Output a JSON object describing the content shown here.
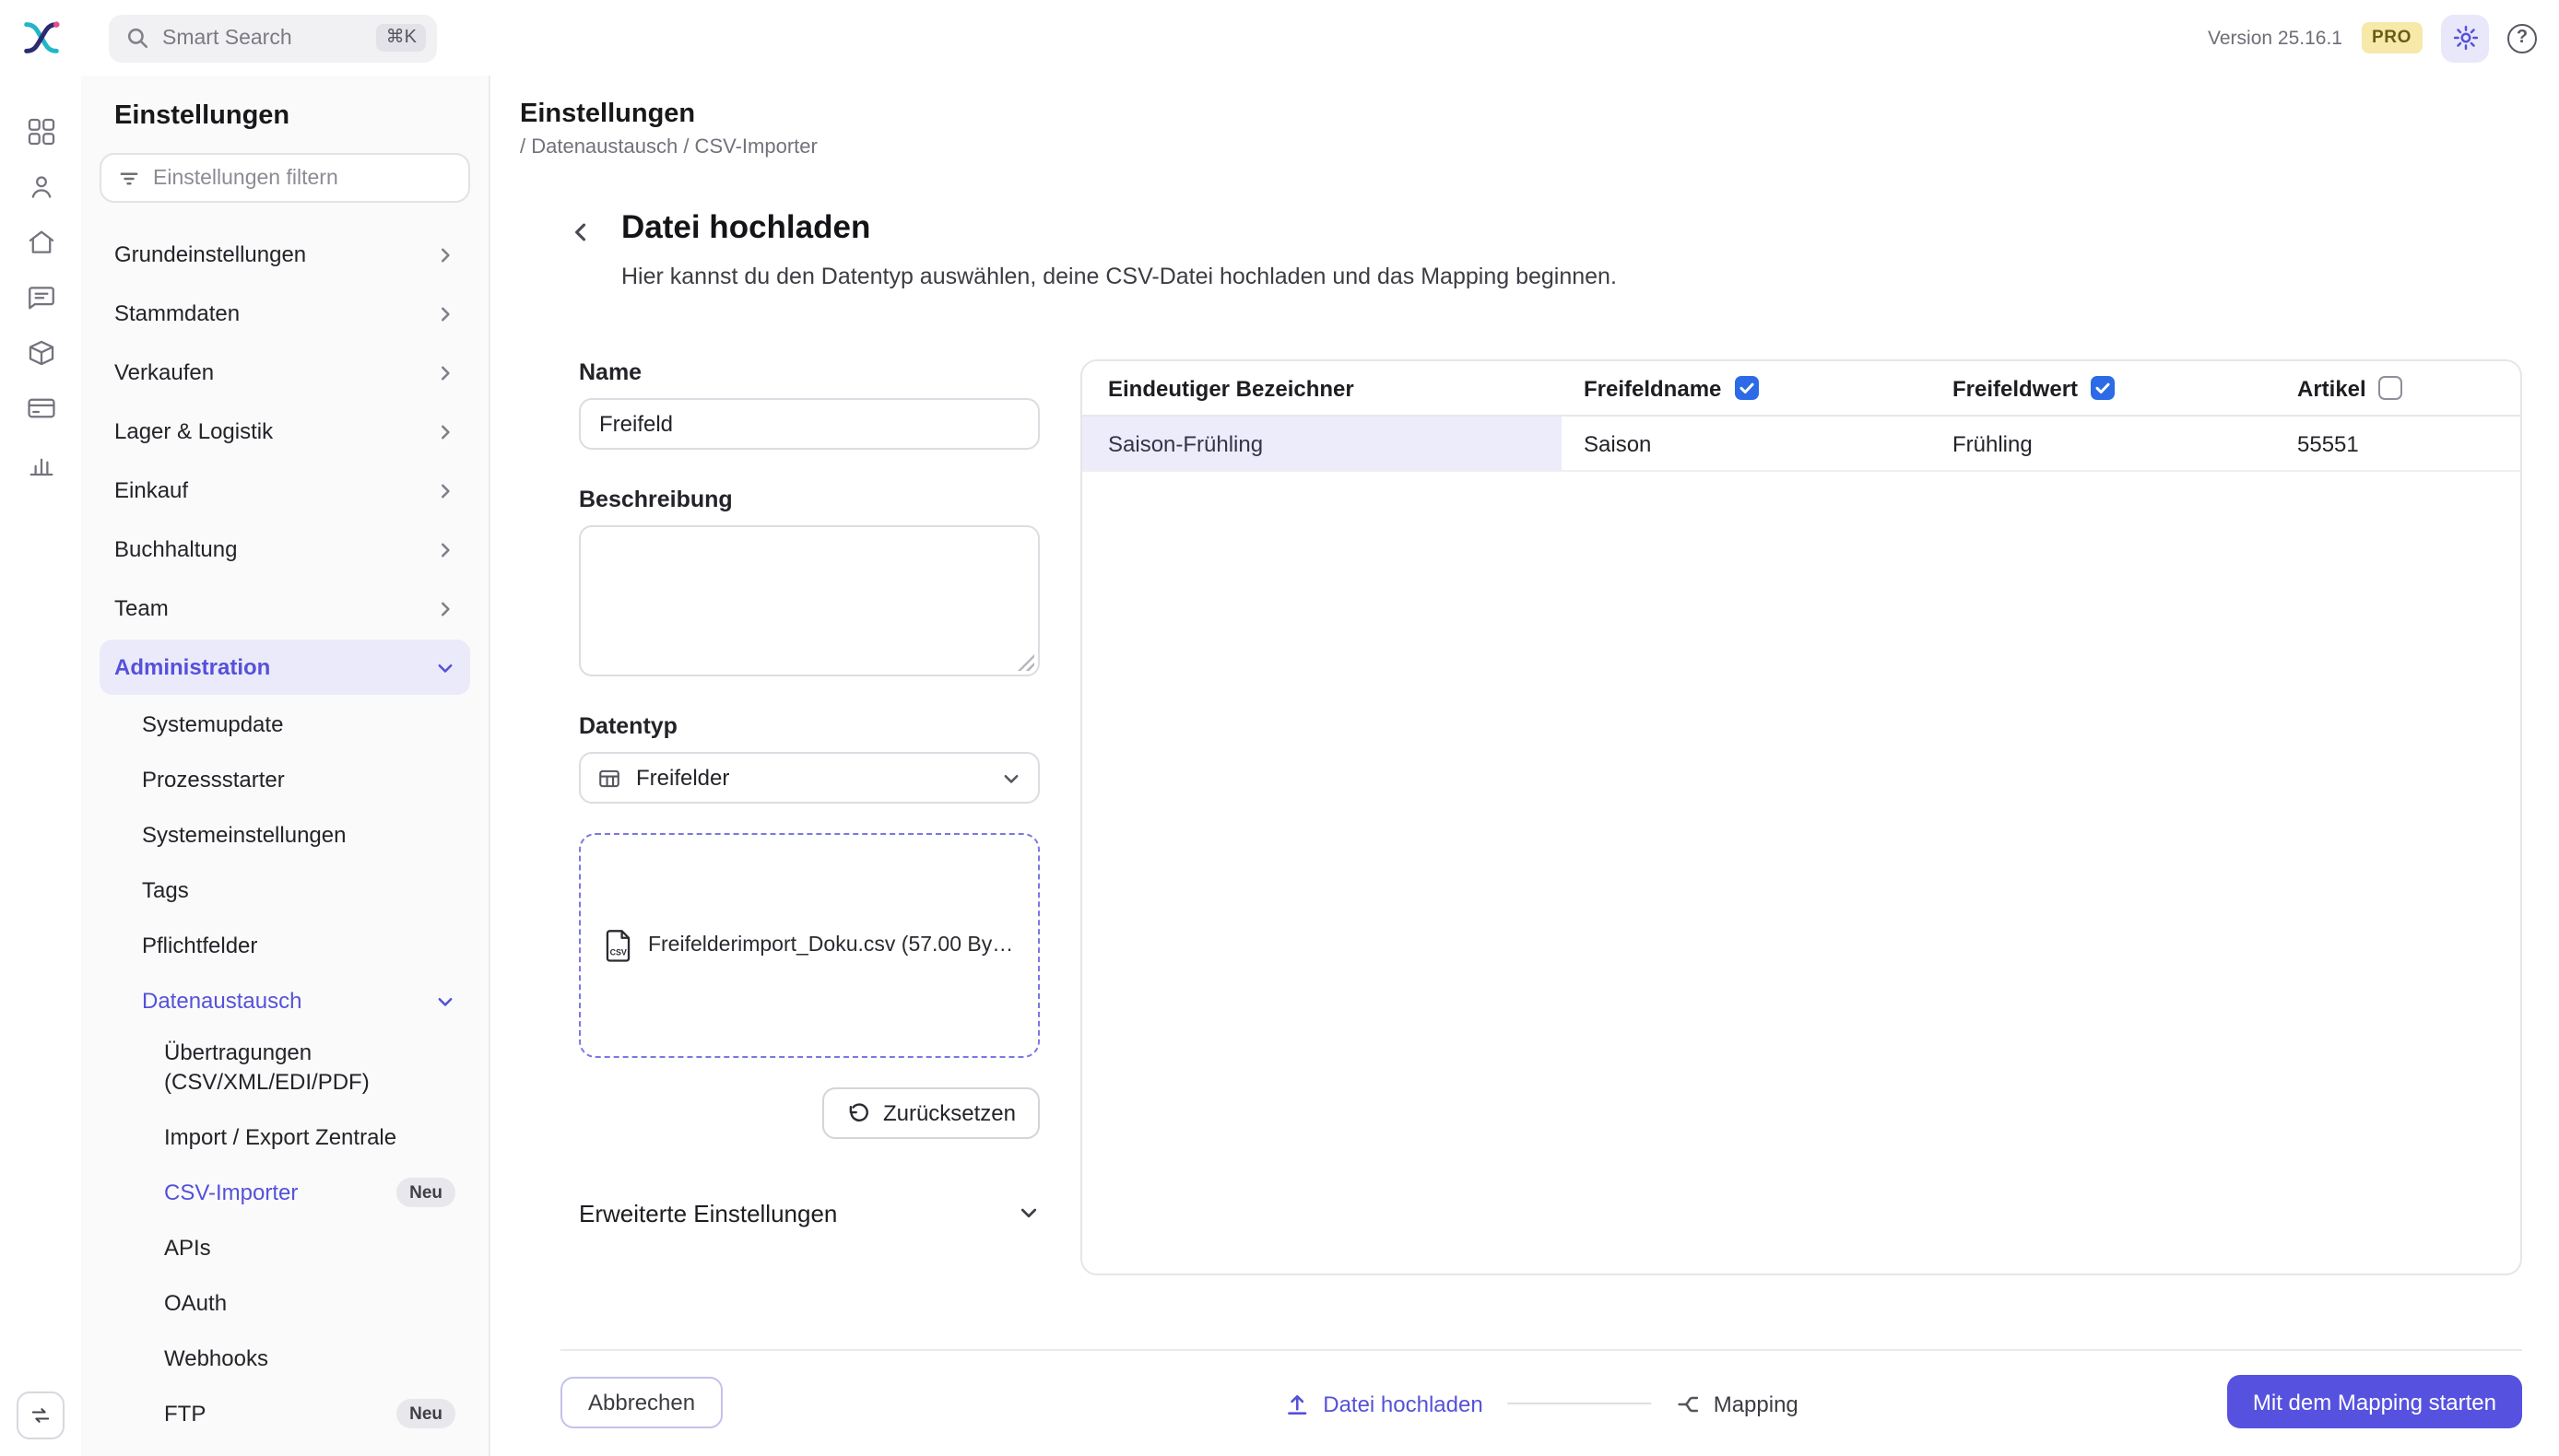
{
  "colors": {
    "accent": "#5551d9",
    "primary_button_bg": "#5652df",
    "active_item_bg": "#ebeafb",
    "checkbox_checked": "#2c6be5",
    "pro_badge_bg": "#f6e9a9"
  },
  "topbar": {
    "search_placeholder": "Smart Search",
    "search_shortcut": "⌘K",
    "version": "Version 25.16.1",
    "pro_label": "PRO"
  },
  "sidebar": {
    "title": "Einstellungen",
    "filter_placeholder": "Einstellungen filtern",
    "items": [
      {
        "label": "Grundeinstellungen"
      },
      {
        "label": "Stammdaten"
      },
      {
        "label": "Verkaufen"
      },
      {
        "label": "Lager & Logistik"
      },
      {
        "label": "Einkauf"
      },
      {
        "label": "Buchhaltung"
      },
      {
        "label": "Team"
      },
      {
        "label": "Administration",
        "active": true,
        "expanded": true
      }
    ],
    "admin_children": [
      {
        "label": "Systemupdate"
      },
      {
        "label": "Prozessstarter"
      },
      {
        "label": "Systemeinstellungen"
      },
      {
        "label": "Tags"
      },
      {
        "label": "Pflichtfelder"
      },
      {
        "label": "Datenaustausch",
        "expanded": true
      }
    ],
    "datenaustausch_children": [
      {
        "label": "Übertragungen (CSV/XML/EDI/PDF)"
      },
      {
        "label": "Import / Export Zentrale"
      },
      {
        "label": "CSV-Importer",
        "badge": "Neu",
        "active": true
      },
      {
        "label": "APIs"
      },
      {
        "label": "OAuth"
      },
      {
        "label": "Webhooks"
      },
      {
        "label": "FTP",
        "badge": "Neu"
      }
    ]
  },
  "main": {
    "header_title": "Einstellungen",
    "breadcrumb": "/ Datenaustausch / CSV-Importer",
    "page_title": "Datei hochladen",
    "page_subtitle": "Hier kannst du den Datentyp auswählen, deine CSV-Datei hochladen und das Mapping beginnen."
  },
  "form": {
    "name_label": "Name",
    "name_value": "Freifeld",
    "description_label": "Beschreibung",
    "description_value": "",
    "datatype_label": "Datentyp",
    "datatype_value": "Freifelder",
    "upload_file": "Freifelderimport_Doku.csv (57.00 Byte...",
    "reset_label": "Zurücksetzen",
    "advanced_label": "Erweiterte Einstellungen"
  },
  "table": {
    "columns": [
      {
        "label": "Eindeutiger Bezeichner",
        "checkbox": "none"
      },
      {
        "label": "Freifeldname",
        "checkbox": "checked"
      },
      {
        "label": "Freifeldwert",
        "checkbox": "checked"
      },
      {
        "label": "Artikel",
        "checkbox": "unchecked"
      }
    ],
    "rows": [
      [
        "Saison-Frühling",
        "Saison",
        "Frühling",
        "55551"
      ]
    ]
  },
  "footer": {
    "cancel_label": "Abbrechen",
    "steps": [
      {
        "label": "Datei hochladen",
        "active": true
      },
      {
        "label": "Mapping",
        "active": false
      }
    ],
    "primary_label": "Mit dem Mapping starten"
  }
}
